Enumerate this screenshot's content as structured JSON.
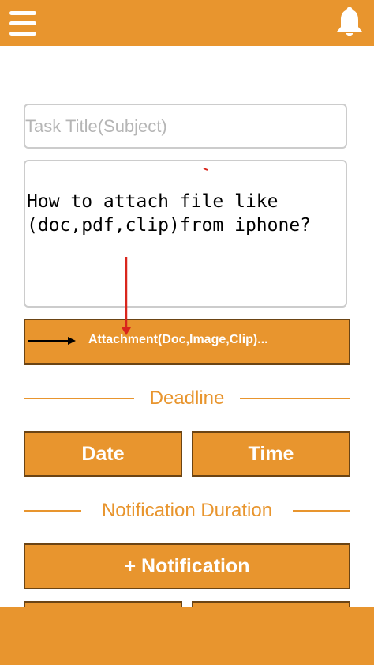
{
  "header": {
    "menu_icon": "hamburger-menu-icon",
    "bell_icon": "bell-icon",
    "accent": "#e8952e"
  },
  "form": {
    "title_placeholder": "Task Title(Subject)",
    "description_line1": "How to attach file like",
    "description_line2": "(doc,pdf,clip)from iphone?",
    "attachment_label": "Attachment(Doc,Image,Clip)..."
  },
  "deadline": {
    "section_label": "Deadline",
    "date_label": "Date",
    "time_label": "Time"
  },
  "notification": {
    "section_label": "Notification Duration",
    "add_label": "+ Notification"
  }
}
